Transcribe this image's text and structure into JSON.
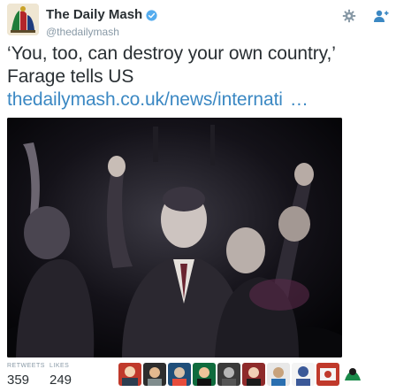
{
  "tweet": {
    "author": {
      "name": "The Daily Mash",
      "handle": "@thedailymash",
      "avatar_icon": "daily-mash-logo-icon",
      "verified_icon": "verified-badge-icon"
    },
    "actions": {
      "settings_icon": "gear-icon",
      "follow_icon": "follow-user-icon"
    },
    "text": {
      "line1": "‘You, too, can destroy your own country,’",
      "line2": "Farage tells US",
      "link": "thedailymash.co.uk/news/internati",
      "ellipsis": "…"
    },
    "media": {
      "icon": "photo-icon"
    },
    "stats": {
      "retweets_label": "RETWEETS",
      "retweets_value": "359",
      "likes_label": "LIKES",
      "likes_value": "249"
    },
    "likers_count": 10,
    "colors": {
      "link": "#3b88c3",
      "name": "#292f33",
      "muted": "#8899a6",
      "verified": "#55acee"
    }
  }
}
